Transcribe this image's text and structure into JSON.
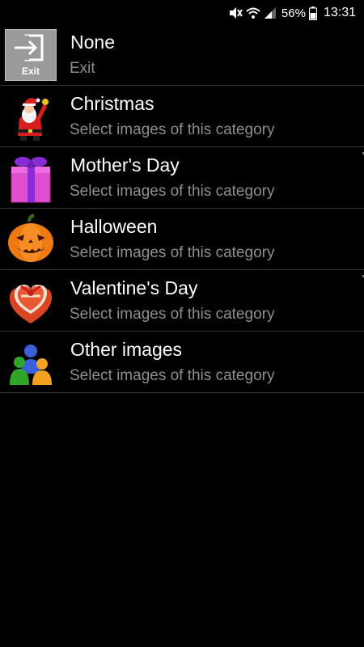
{
  "status_bar": {
    "battery_percent": "56%",
    "time": "13:31",
    "icons": [
      "mute-icon",
      "wifi-icon",
      "signal-icon",
      "battery-icon"
    ]
  },
  "items": [
    {
      "title": "None",
      "subtitle": "Exit",
      "icon": "exit-icon",
      "icon_label": "Exit"
    },
    {
      "title": "Christmas",
      "subtitle": "Select images of this category",
      "icon": "santa-icon"
    },
    {
      "title": "Mother's Day",
      "subtitle": "Select images of this category",
      "icon": "gift-icon"
    },
    {
      "title": "Halloween",
      "subtitle": "Select images of this category",
      "icon": "pumpkin-icon"
    },
    {
      "title": "Valentine's Day",
      "subtitle": "Select images of this category",
      "icon": "heart-box-icon"
    },
    {
      "title": "Other images",
      "subtitle": "Select images of this category",
      "icon": "people-icon"
    }
  ],
  "colors": {
    "background": "#000000",
    "title_text": "#ffffff",
    "subtitle_text": "#8e8e8e",
    "divider": "#3a3a3a"
  }
}
